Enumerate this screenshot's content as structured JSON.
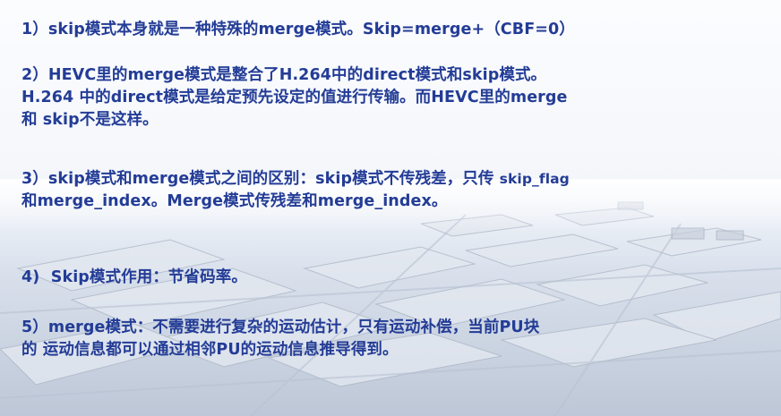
{
  "slide": {
    "p1": {
      "line1": "1）skip模式本身就是一种特殊的merge模式。Skip=merge+（CBF=0）"
    },
    "p2": {
      "line1": "2）HEVC里的merge模式是整合了H.264中的direct模式和skip模式。",
      "line2": "H.264 中的direct模式是给定预先设定的值进行传输。而HEVC里的merge",
      "line3": "和 skip不是这样。"
    },
    "p3": {
      "line1_main": "3）skip模式和merge模式之间的区别：skip模式不传残差，只传 ",
      "line1_small": "skip_flag",
      "line2": "和merge_index。Merge模式传残差和merge_index。"
    },
    "p4": {
      "line1": "4)  Skip模式作用：节省码率。"
    },
    "p5": {
      "line1": "5）merge模式：不需要进行复杂的运动估计，只有运动补偿，当前PU块",
      "line2": "的 运动信息都可以通过相邻PU的运动信息推导得到。"
    }
  },
  "colors": {
    "text": "#233c96",
    "background": "#f4f6fa"
  }
}
